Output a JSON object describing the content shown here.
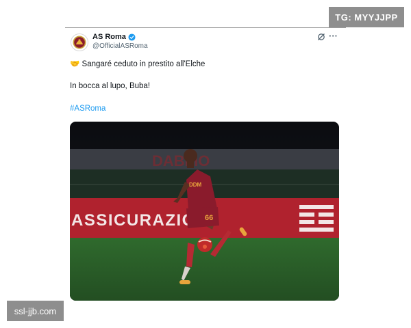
{
  "watermarks": {
    "top_right": "TG: MYYJJPP",
    "bottom_left": "ssl-jjb.com"
  },
  "tweet": {
    "author_name": "AS Roma",
    "author_handle": "@OfficialASRoma",
    "verified": true,
    "lines": [
      {
        "emoji": "🤝",
        "text": "Sangaré ceduto in prestito all'Elche"
      },
      {
        "text": "In bocca al lupo, Buba!"
      },
      {
        "hashtag": "#ASRoma"
      }
    ],
    "media": {
      "banner_text": "ASSICURAZIONI",
      "upper_banner_text": "DABLIO",
      "player_number": "66",
      "shirt_sponsor": "DDM",
      "colors": {
        "shirt": "#8a1b2c",
        "banner": "#b0222e",
        "pitch": "#2c5f2a",
        "accent": "#e8a43c"
      }
    }
  },
  "colors": {
    "link": "#1d9bf0",
    "secondary_text": "#536471",
    "watermark_bg": "#8e8e8e"
  }
}
